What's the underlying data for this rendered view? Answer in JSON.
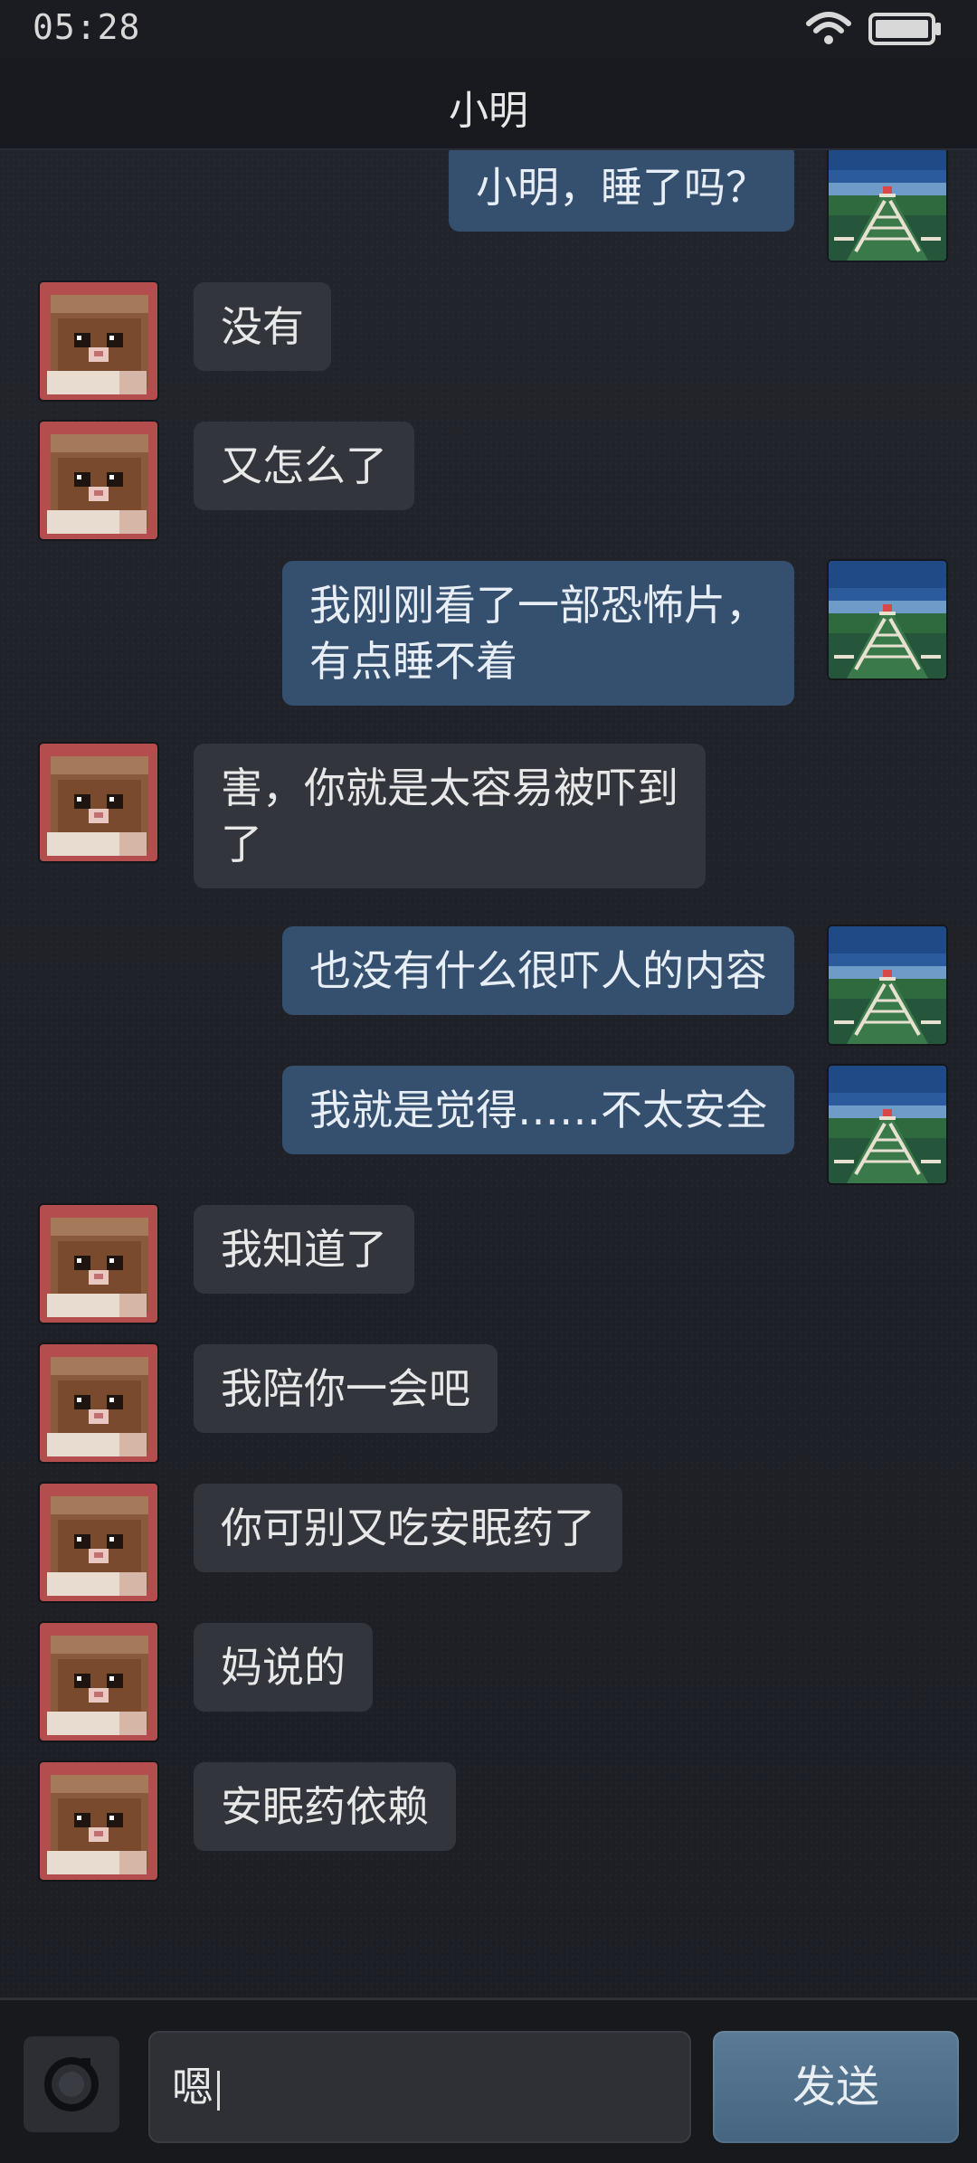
{
  "status_bar": {
    "time": "05:28",
    "wifi_icon": "wifi-icon",
    "battery_icon": "battery-icon"
  },
  "header": {
    "title": "小明"
  },
  "contact_avatar": "hamster-avatar",
  "self_avatar": "railway-avatar",
  "messages": [
    {
      "side": "right",
      "text": "小明，睡了吗？"
    },
    {
      "side": "left",
      "text": "没有"
    },
    {
      "side": "left",
      "text": "又怎么了"
    },
    {
      "side": "right",
      "text": "我刚刚看了一部恐怖片，\n有点睡不着"
    },
    {
      "side": "left",
      "text": "害，你就是太容易被吓到\n了"
    },
    {
      "side": "right",
      "text": "也没有什么很吓人的内容"
    },
    {
      "side": "right",
      "text": "我就是觉得……不太安全"
    },
    {
      "side": "left",
      "text": "我知道了"
    },
    {
      "side": "left",
      "text": "我陪你一会吧"
    },
    {
      "side": "left",
      "text": "你可别又吃安眠药了"
    },
    {
      "side": "left",
      "text": "妈说的"
    },
    {
      "side": "left",
      "text": "安眠药依赖"
    }
  ],
  "input_bar": {
    "camera_icon": "camera-icon",
    "input_value": "嗯",
    "send_label": "发送"
  },
  "colors": {
    "own_bubble": "#354f6e",
    "other_bubble": "#33353c",
    "send_button": "#466580"
  }
}
